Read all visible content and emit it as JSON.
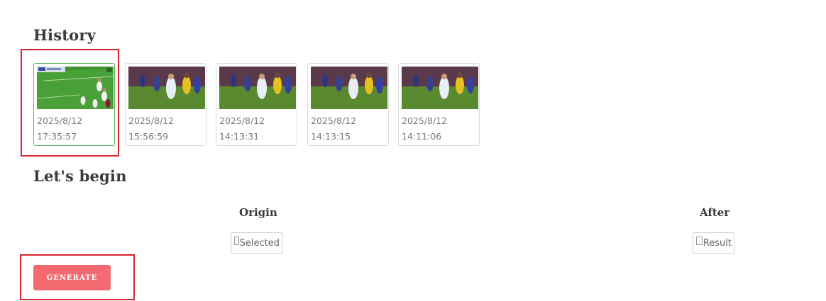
{
  "history": {
    "heading": "History",
    "items": [
      {
        "date": "2025/8/12",
        "time": "17:35:57",
        "thumb": "soccer-wide-shot"
      },
      {
        "date": "2025/8/12",
        "time": "15:56:59",
        "thumb": "soccer-closeup"
      },
      {
        "date": "2025/8/12",
        "time": "14:13:31",
        "thumb": "soccer-closeup"
      },
      {
        "date": "2025/8/12",
        "time": "14:13:15",
        "thumb": "soccer-closeup"
      },
      {
        "date": "2025/8/12",
        "time": "14:11:06",
        "thumb": "soccer-closeup"
      }
    ]
  },
  "begin": {
    "heading": "Let's begin",
    "origin_label": "Origin",
    "after_label": "After",
    "origin_alt": "Selected",
    "after_alt": "Result"
  },
  "actions": {
    "generate_label": "GENERATE"
  },
  "colors": {
    "accent_button": "#f36b70",
    "selected_border": "#5cb85c",
    "highlight_box": "#d9232d"
  }
}
